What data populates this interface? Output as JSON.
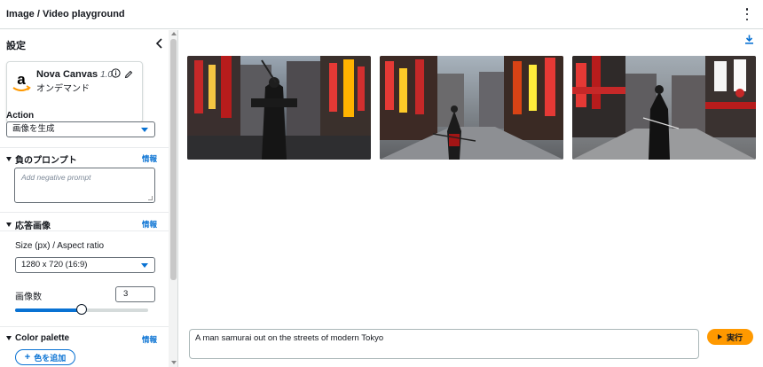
{
  "header": {
    "title": "Image / Video playground"
  },
  "settings": {
    "title": "設定",
    "model": {
      "name": "Nova Canvas",
      "version": "1.0",
      "mode": "オンデマンド"
    },
    "action": {
      "label": "Action",
      "value": "画像を生成"
    },
    "negative_prompt": {
      "heading": "負のプロンプト",
      "info": "情報",
      "placeholder": "Add negative prompt"
    },
    "response_image": {
      "heading": "応答画像",
      "info": "情報",
      "size_label": "Size (px) / Aspect ratio",
      "size_value": "1280 x 720 (16:9)",
      "count_label": "画像数",
      "count_value": "3",
      "slider_fraction": 0.5
    },
    "color_palette": {
      "heading": "Color palette",
      "info": "情報",
      "add_label": "色を追加"
    }
  },
  "output": {
    "images": [
      {
        "name": "generated-image-1"
      },
      {
        "name": "generated-image-2"
      },
      {
        "name": "generated-image-3"
      }
    ]
  },
  "prompt": {
    "text": "A man samurai out on the streets of modern Tokyo",
    "run_label": "実行"
  },
  "colors": {
    "accent": "#0972d3",
    "primary_button": "#ff9900",
    "text": "#16191f",
    "border": "#d5dbdb"
  },
  "icons": [
    "kebab-menu-icon",
    "chevron-left-icon",
    "amazon-logo-icon",
    "info-icon",
    "edit-icon",
    "caret-down-icon",
    "triangle-expanded-icon",
    "plus-icon",
    "download-icon",
    "play-icon"
  ]
}
